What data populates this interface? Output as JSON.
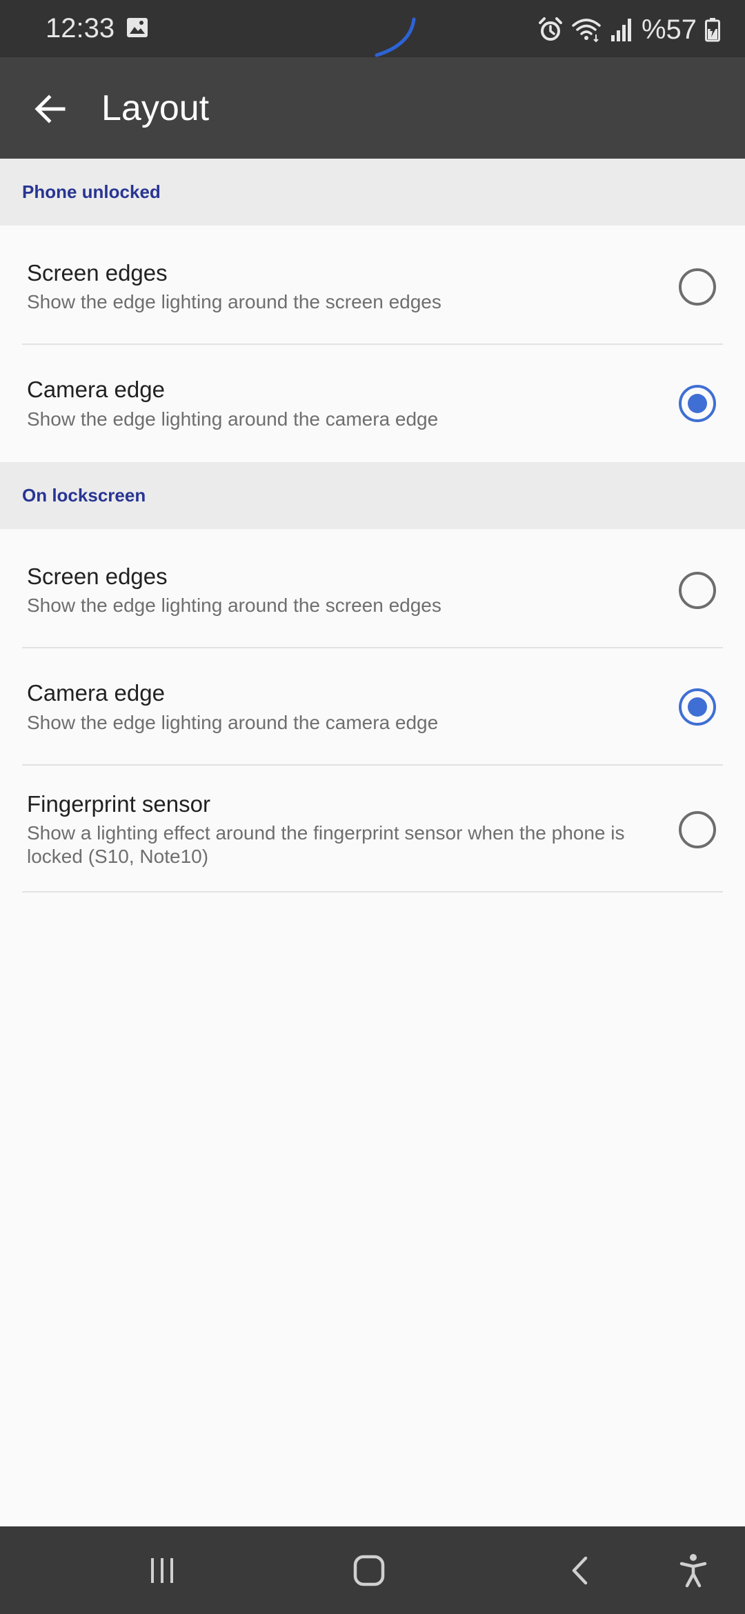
{
  "status_bar": {
    "time": "12:33",
    "battery_text": "%57",
    "icons": [
      "image-icon",
      "alarm-icon",
      "wifi-icon",
      "signal-icon",
      "battery-charging-icon"
    ]
  },
  "app_bar": {
    "title": "Layout",
    "back_icon": "arrow-back-icon"
  },
  "sections": [
    {
      "header": "Phone unlocked",
      "items": [
        {
          "title": "Screen edges",
          "subtitle": "Show  the edge lighting around the screen edges",
          "selected": false
        },
        {
          "title": "Camera edge",
          "subtitle": "Show the edge lighting around the camera edge",
          "selected": true
        }
      ]
    },
    {
      "header": "On lockscreen",
      "items": [
        {
          "title": "Screen edges",
          "subtitle": "Show  the edge lighting around the screen edges",
          "selected": false
        },
        {
          "title": "Camera edge",
          "subtitle": "Show the edge lighting around the camera edge",
          "selected": true
        },
        {
          "title": "Fingerprint sensor",
          "subtitle": "Show a lighting effect around the fingerprint sensor when the phone is locked (S10, Note10)",
          "selected": false
        }
      ]
    }
  ],
  "nav_bar": {
    "icons": [
      "recents-icon",
      "home-icon",
      "back-icon",
      "accessibility-icon"
    ]
  },
  "colors": {
    "accent": "#3f6fd4",
    "section_header_text": "#283593",
    "app_bar": "#424242",
    "status_bar": "#333333"
  }
}
